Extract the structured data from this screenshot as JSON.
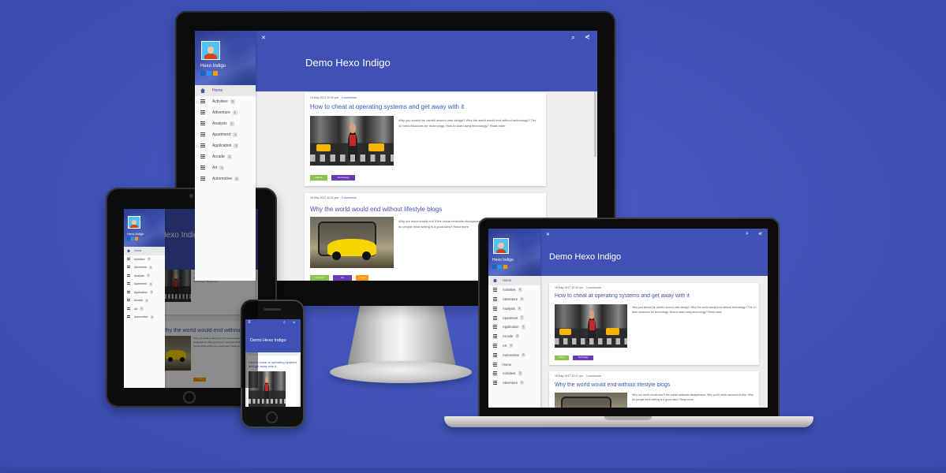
{
  "blog": {
    "title": "Demo Hexo Indigo",
    "author": "Hexo Indigo",
    "menu": [
      {
        "label": "Home",
        "count": ""
      },
      {
        "label": "Activities",
        "count": "2"
      },
      {
        "label": "Adventure",
        "count": "1"
      },
      {
        "label": "Analysis",
        "count": "1"
      },
      {
        "label": "Apartment",
        "count": "1"
      },
      {
        "label": "Application",
        "count": "1"
      },
      {
        "label": "Arcade",
        "count": "2"
      },
      {
        "label": "Art",
        "count": "1"
      },
      {
        "label": "Automotive",
        "count": "2"
      }
    ],
    "posts": [
      {
        "meta_date": "18 May 2017 10:30 pm",
        "meta_comments": "0 comments",
        "title": "How to cheat at operating systems and get away with it",
        "excerpt": "Why you should be careful around web design? Why the world would end without technology? The 10 best resources for technology. How to start using technology? Read more",
        "read_more": "Read more",
        "tags": [
          "Nature",
          "Technology"
        ]
      },
      {
        "meta_date": "18 May 2017 12:21 pm",
        "meta_comments": "0 comments",
        "title": "Why the world would end without lifestyle blogs",
        "excerpt": "Why our world would end if the social networks disappeared. Why you'll never succeed at film. Why do people think writing is a good idea? Read more",
        "read_more": "Read more",
        "tags": [
          "Lifestyle",
          "Art",
          "Travel"
        ]
      }
    ]
  },
  "colors": {
    "primary": "#3f51b5",
    "background": "#3f51b5",
    "tag_green": "#8bc34a",
    "tag_purple": "#673ab7",
    "tag_orange": "#ff9800",
    "social_blue": "#2196f3",
    "social_orange": "#ff9800"
  },
  "icons": {
    "close": "✕",
    "search": "⌕",
    "share": "⋞",
    "menu": "≡"
  }
}
